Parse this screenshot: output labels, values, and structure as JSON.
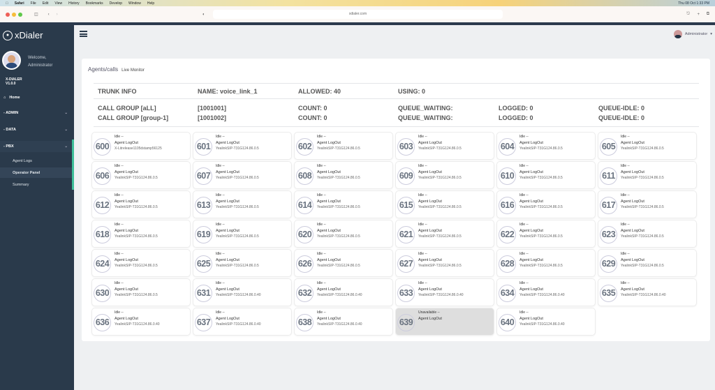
{
  "os_menu": {
    "app": "Safari",
    "items": [
      "File",
      "Edit",
      "View",
      "History",
      "Bookmarks",
      "Develop",
      "Window",
      "Help"
    ],
    "clock": "Thu 08 Oct  1:33 PM"
  },
  "browser": {
    "url": "xdialer.com"
  },
  "sidebar": {
    "brand": "xDialer",
    "welcome": "Welcome,",
    "user": "Administrator",
    "product": "X-DIALER",
    "version": "V1.0.0",
    "nav": [
      {
        "label": "Home"
      },
      {
        "label": "- ADMIN"
      },
      {
        "label": "- DATA"
      },
      {
        "label": "- PBX"
      }
    ],
    "sub": [
      {
        "label": "Agent Logs"
      },
      {
        "label": "Operator Panel"
      },
      {
        "label": "Summary"
      }
    ]
  },
  "header": {
    "user": "Administrator"
  },
  "breadcrumb": {
    "title": "Agents/calls",
    "sub": "Live Monitor"
  },
  "trunk": {
    "label": "TRUNK INFO",
    "name": "NAME: voice_link_1",
    "allowed": "ALLOWED: 40",
    "using": "USING: 0"
  },
  "groups": [
    {
      "label": "CALL GROUP [aLL]",
      "id": "[1001001]",
      "count": "COUNT: 0",
      "queue": "QUEUE_WAITING:",
      "logged": "LOGGED: 0",
      "idle": "QUEUE-IDLE: 0"
    },
    {
      "label": "CALL GROUP [group-1]",
      "id": "[1001002]",
      "count": "COUNT: 0",
      "queue": "QUEUE_WAITING:",
      "logged": "LOGGED: 0",
      "idle": "QUEUE-IDLE: 0"
    }
  ],
  "agents": [
    {
      "ext": "600",
      "status": "Idle --",
      "state": "Agent LogOut",
      "device": "X-Litrelease1105dstamp56125"
    },
    {
      "ext": "601",
      "status": "Idle --",
      "state": "Agent LogOut",
      "device": "YealinkSIP-T31G124.86.0.5"
    },
    {
      "ext": "602",
      "status": "Idle --",
      "state": "Agent LogOut",
      "device": "YealinkSIP-T31G124.86.0.5"
    },
    {
      "ext": "603",
      "status": "Idle --",
      "state": "Agent LogOut",
      "device": "YealinkSIP-T31G124.86.0.5"
    },
    {
      "ext": "604",
      "status": "Idle --",
      "state": "Agent LogOut",
      "device": "YealinkSIP-T31G124.86.0.5"
    },
    {
      "ext": "605",
      "status": "Idle --",
      "state": "Agent LogOut",
      "device": "YealinkSIP-T31G124.86.0.5"
    },
    {
      "ext": "606",
      "status": "Idle --",
      "state": "Agent LogOut",
      "device": "YealinkSIP-T31G124.86.0.5"
    },
    {
      "ext": "607",
      "status": "Idle --",
      "state": "Agent LogOut",
      "device": "YealinkSIP-T31G124.86.0.5"
    },
    {
      "ext": "608",
      "status": "Idle --",
      "state": "Agent LogOut",
      "device": "YealinkSIP-T31G124.86.0.5"
    },
    {
      "ext": "609",
      "status": "Idle --",
      "state": "Agent LogOut",
      "device": "YealinkSIP-T31G124.86.0.5"
    },
    {
      "ext": "610",
      "status": "Idle --",
      "state": "Agent LogOut",
      "device": "YealinkSIP-T31G124.86.0.5"
    },
    {
      "ext": "611",
      "status": "Idle --",
      "state": "Agent LogOut",
      "device": "YealinkSIP-T31G124.86.0.5"
    },
    {
      "ext": "612",
      "status": "Idle --",
      "state": "Agent LogOut",
      "device": "YealinkSIP-T31G124.86.0.5"
    },
    {
      "ext": "613",
      "status": "Idle --",
      "state": "Agent LogOut",
      "device": "YealinkSIP-T31G124.86.0.5"
    },
    {
      "ext": "614",
      "status": "Idle --",
      "state": "Agent LogOut",
      "device": "YealinkSIP-T31G124.86.0.5"
    },
    {
      "ext": "615",
      "status": "Idle --",
      "state": "Agent LogOut",
      "device": "YealinkSIP-T31G124.86.0.5"
    },
    {
      "ext": "616",
      "status": "Idle --",
      "state": "Agent LogOut",
      "device": "YealinkSIP-T31G124.86.0.5"
    },
    {
      "ext": "617",
      "status": "Idle --",
      "state": "Agent LogOut",
      "device": "YealinkSIP-T31G124.86.0.5"
    },
    {
      "ext": "618",
      "status": "Idle --",
      "state": "Agent LogOut",
      "device": "YealinkSIP-T31G124.86.0.5"
    },
    {
      "ext": "619",
      "status": "Idle --",
      "state": "Agent LogOut",
      "device": "YealinkSIP-T31G124.86.0.5"
    },
    {
      "ext": "620",
      "status": "Idle --",
      "state": "Agent LogOut",
      "device": "YealinkSIP-T31G124.86.0.5"
    },
    {
      "ext": "621",
      "status": "Idle --",
      "state": "Agent LogOut",
      "device": "YealinkSIP-T31G124.86.0.5"
    },
    {
      "ext": "622",
      "status": "Idle --",
      "state": "Agent LogOut",
      "device": "YealinkSIP-T31G124.86.0.5"
    },
    {
      "ext": "623",
      "status": "Idle --",
      "state": "Agent LogOut",
      "device": "YealinkSIP-T31G124.86.0.5"
    },
    {
      "ext": "624",
      "status": "Idle --",
      "state": "Agent LogOut",
      "device": "YealinkSIP-T31G124.86.0.5"
    },
    {
      "ext": "625",
      "status": "Idle --",
      "state": "Agent LogOut",
      "device": "YealinkSIP-T31G124.86.0.5"
    },
    {
      "ext": "626",
      "status": "Idle --",
      "state": "Agent LogOut",
      "device": "YealinkSIP-T31G124.86.0.5"
    },
    {
      "ext": "627",
      "status": "Idle --",
      "state": "Agent LogOut",
      "device": "YealinkSIP-T31G124.86.0.5"
    },
    {
      "ext": "628",
      "status": "Idle --",
      "state": "Agent LogOut",
      "device": "YealinkSIP-T31G124.86.0.5"
    },
    {
      "ext": "629",
      "status": "Idle --",
      "state": "Agent LogOut",
      "device": "YealinkSIP-T31G124.86.0.5"
    },
    {
      "ext": "630",
      "status": "Idle --",
      "state": "Agent LogOut",
      "device": "YealinkSIP-T31G124.86.0.5"
    },
    {
      "ext": "631",
      "status": "Idle --",
      "state": "Agent LogOut",
      "device": "YealinkSIP-T31G124.86.0.40"
    },
    {
      "ext": "632",
      "status": "Idle --",
      "state": "Agent LogOut",
      "device": "YealinkSIP-T31G124.86.0.40"
    },
    {
      "ext": "633",
      "status": "Idle --",
      "state": "Agent LogOut",
      "device": "YealinkSIP-T31G124.86.0.40"
    },
    {
      "ext": "634",
      "status": "Idle --",
      "state": "Agent LogOut",
      "device": "YealinkSIP-T31G124.86.0.40"
    },
    {
      "ext": "635",
      "status": "Idle --",
      "state": "Agent LogOut",
      "device": "YealinkSIP-T31G124.86.0.40"
    },
    {
      "ext": "636",
      "status": "Idle --",
      "state": "Agent LogOut",
      "device": "YealinkSIP-T31G124.86.0.40"
    },
    {
      "ext": "637",
      "status": "Idle --",
      "state": "Agent LogOut",
      "device": "YealinkSIP-T31G124.86.0.40"
    },
    {
      "ext": "638",
      "status": "Idle --",
      "state": "Agent LogOut",
      "device": "YealinkSIP-T31G124.86.0.40"
    },
    {
      "ext": "639",
      "status": "Unavailable --",
      "state": "Agent LogOut",
      "device": "",
      "unavailable": true
    },
    {
      "ext": "640",
      "status": "Idle --",
      "state": "Agent LogOut",
      "device": "YealinkSIP-T31G124.86.0.40"
    }
  ]
}
